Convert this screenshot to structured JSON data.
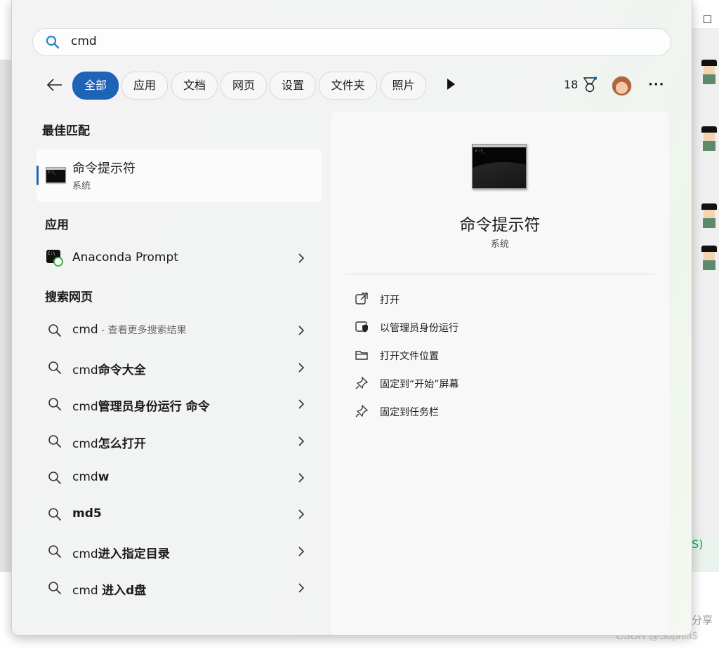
{
  "background": {
    "snippet_green": "S)",
    "share_text": "分享",
    "watermark": "CSDN @Sophia$"
  },
  "search": {
    "query": "cmd",
    "icon": "search-icon"
  },
  "filters": {
    "back_icon": "back-arrow-icon",
    "tabs": [
      {
        "label": "全部",
        "active": true
      },
      {
        "label": "应用",
        "active": false
      },
      {
        "label": "文档",
        "active": false
      },
      {
        "label": "网页",
        "active": false
      },
      {
        "label": "设置",
        "active": false
      },
      {
        "label": "文件夹",
        "active": false
      },
      {
        "label": "照片",
        "active": false
      }
    ],
    "more_tabs_icon": "play-icon",
    "points": "18",
    "more_label": "···"
  },
  "sections": {
    "best_match": "最佳匹配",
    "apps": "应用",
    "web": "搜索网页"
  },
  "best_match": {
    "name": "命令提示符",
    "type": "系统"
  },
  "apps": [
    {
      "name": "Anaconda Prompt"
    }
  ],
  "web_results": [
    {
      "prefix": "cmd",
      "bold": "",
      "hint": " - 查看更多搜索结果"
    },
    {
      "prefix": "cmd",
      "bold": "命令大全",
      "hint": ""
    },
    {
      "prefix": "cmd",
      "bold": "管理员身份运行 命令",
      "hint": ""
    },
    {
      "prefix": "cmd",
      "bold": "怎么打开",
      "hint": ""
    },
    {
      "prefix": "cmd",
      "bold": "w",
      "hint": ""
    },
    {
      "prefix": "",
      "bold": "md5",
      "hint": ""
    },
    {
      "prefix": "cmd",
      "bold": "进入指定目录",
      "hint": ""
    },
    {
      "prefix": "cmd ",
      "bold": "进入d盘",
      "hint": ""
    }
  ],
  "preview": {
    "title": "命令提示符",
    "subtitle": "系统",
    "actions": [
      {
        "label": "打开",
        "icon": "open-external-icon"
      },
      {
        "label": "以管理员身份运行",
        "icon": "shield-admin-icon"
      },
      {
        "label": "打开文件位置",
        "icon": "folder-icon"
      },
      {
        "label": "固定到“开始”屏幕",
        "icon": "pin-icon"
      },
      {
        "label": "固定到任务栏",
        "icon": "pin-icon"
      }
    ]
  },
  "colors": {
    "accent": "#1d63b8",
    "panel_bg": "#f3f3f3"
  }
}
